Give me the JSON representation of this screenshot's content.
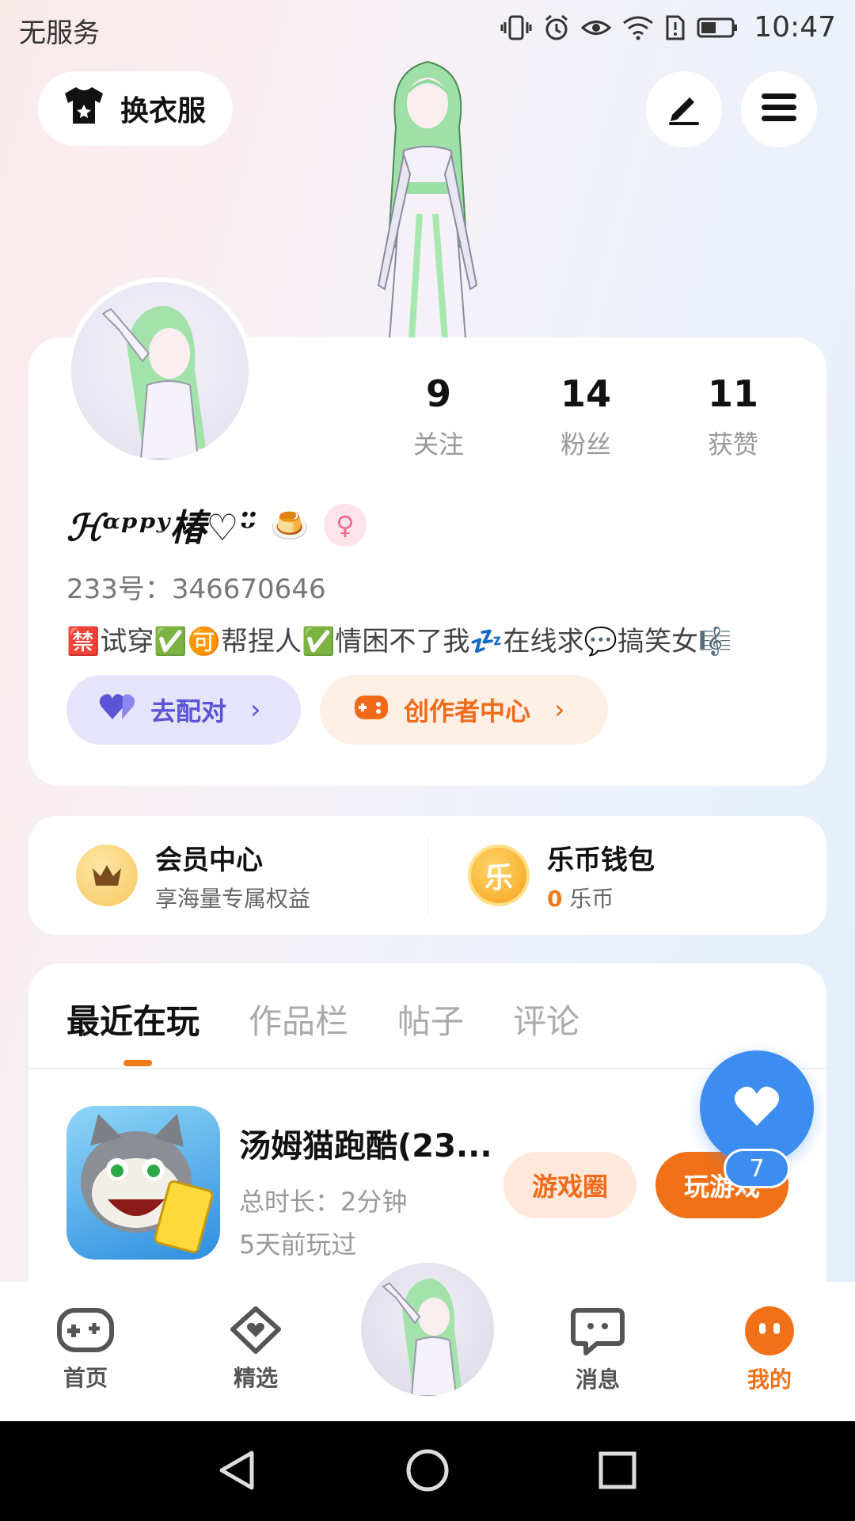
{
  "status_bar": {
    "carrier": "无服务",
    "time": "10:47"
  },
  "top": {
    "outfit_label": "换衣服"
  },
  "profile": {
    "stats": [
      {
        "value": "9",
        "label": "关注"
      },
      {
        "value": "14",
        "label": "粉丝"
      },
      {
        "value": "11",
        "label": "获赞"
      }
    ],
    "nickname": "ℋᵅᵖᵖʸ椿♡ᵕ̈",
    "id_line": "233号：346670646",
    "bio": "🈲试穿✅🉑帮捏人✅情困不了我💤在线求💬搞笑女🎼",
    "pair_label": "去配对",
    "creator_label": "创作者中心"
  },
  "vip": {
    "member_title": "会员中心",
    "member_sub": "享海量专属权益",
    "wallet_title": "乐币钱包",
    "wallet_amount": "0",
    "wallet_unit": "乐币",
    "wallet_coin_char": "乐"
  },
  "tabs": [
    "最近在玩",
    "作品栏",
    "帖子",
    "评论"
  ],
  "recent_game": {
    "title": "汤姆猫跑酷(23...",
    "duration": "总时长：2分钟",
    "last_played": "5天前玩过",
    "circle_label": "游戏圈",
    "play_label": "玩游戏"
  },
  "like_fab": {
    "count": "7"
  },
  "bottom_nav": [
    {
      "label": "首页",
      "icon": "gamepad-icon"
    },
    {
      "label": "精选",
      "icon": "heart-chat-icon"
    },
    {
      "label": "消息",
      "icon": "message-icon"
    },
    {
      "label": "我的",
      "icon": "me-icon"
    }
  ],
  "colors": {
    "accent": "#f07117",
    "blue": "#3d8df0",
    "pair": "#5b54d6"
  }
}
